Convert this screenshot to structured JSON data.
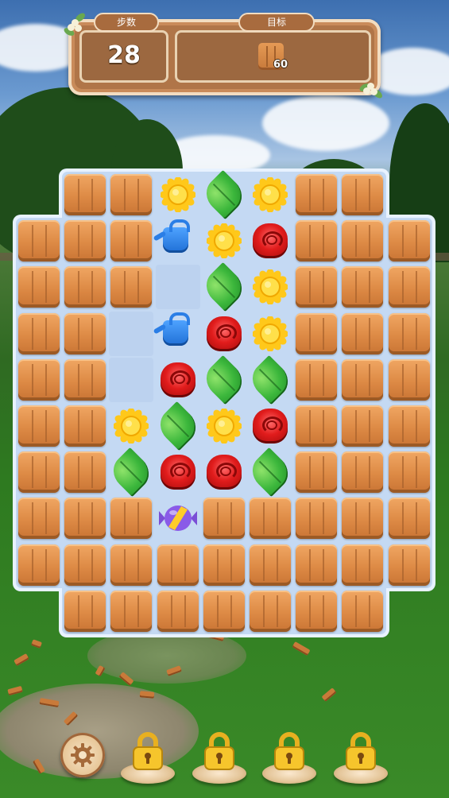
{
  "hud": {
    "moves_label": "步数",
    "moves_value": "28",
    "goal_label": "目标",
    "goal_item_icon": "wood-block-icon",
    "goal_count": "60"
  },
  "board": {
    "rows": 10,
    "cols": 9,
    "grid": [
      [
        null,
        "W",
        "W",
        "S",
        "L",
        "S",
        "W",
        "W",
        null
      ],
      [
        "W",
        "W",
        "W",
        "C",
        "S",
        "R",
        "W",
        "W",
        "W"
      ],
      [
        "W",
        "W",
        "W",
        "E",
        "L",
        "S",
        "W",
        "W",
        "W"
      ],
      [
        "W",
        "W",
        "E",
        "C",
        "R",
        "S",
        "W",
        "W",
        "W"
      ],
      [
        "W",
        "W",
        "E",
        "R",
        "L",
        "L",
        "W",
        "W",
        "W"
      ],
      [
        "W",
        "W",
        "S",
        "L",
        "S",
        "R",
        "W",
        "W",
        "W"
      ],
      [
        "W",
        "W",
        "L",
        "R",
        "R",
        "L",
        "W",
        "W",
        "W"
      ],
      [
        "W",
        "W",
        "W",
        "B",
        "W",
        "W",
        "W",
        "W",
        "W"
      ],
      [
        "W",
        "W",
        "W",
        "W",
        "W",
        "W",
        "W",
        "W",
        "W"
      ],
      [
        null,
        "W",
        "W",
        "W",
        "W",
        "W",
        "W",
        "W",
        null
      ]
    ],
    "legend": {
      "W": "wood-block",
      "S": "sunflower",
      "L": "green-leaf",
      "R": "red-rose",
      "C": "watering-can",
      "B": "striped-candy-booster",
      "E": "empty-cell"
    }
  },
  "controls": {
    "settings_icon": "gear-icon",
    "boosters": [
      {
        "name": "booster-slot-1",
        "state": "locked",
        "icon": "lock-icon"
      },
      {
        "name": "booster-slot-2",
        "state": "locked",
        "icon": "lock-icon"
      },
      {
        "name": "booster-slot-3",
        "state": "locked",
        "icon": "lock-icon"
      },
      {
        "name": "booster-slot-4",
        "state": "locked",
        "icon": "lock-icon"
      }
    ]
  },
  "colors": {
    "wood": "#dd8a45",
    "board_fill": "#c4d9f3",
    "hud_frame": "#c98b5a",
    "leaf": "#3cb73c",
    "rose": "#e11c1c",
    "sun": "#ffd21f",
    "can": "#1f6fd6"
  }
}
